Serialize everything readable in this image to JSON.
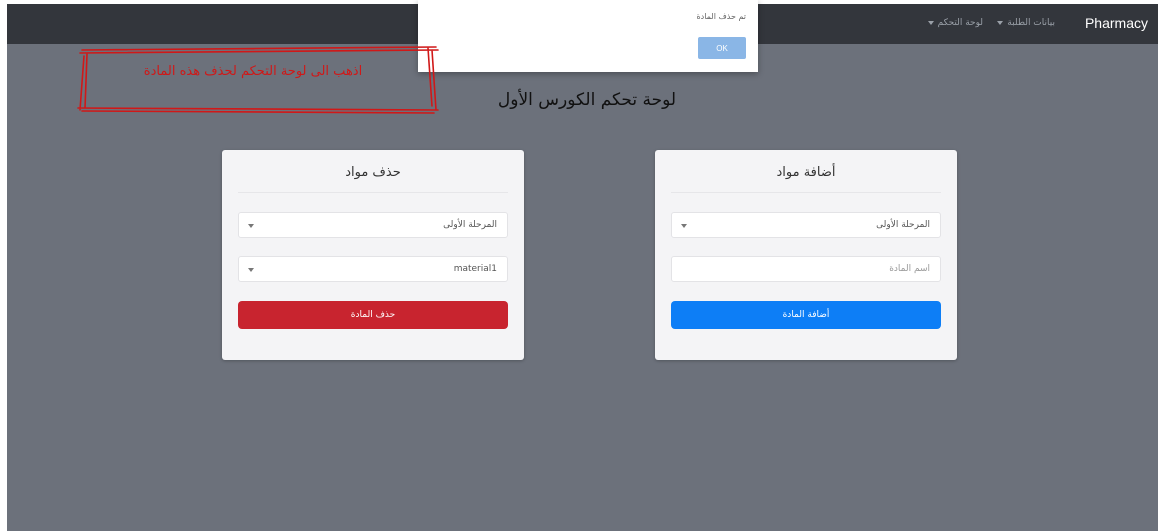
{
  "navbar": {
    "brand": "Pharmacy",
    "items": [
      {
        "label": "بيانات الطلبة"
      },
      {
        "label": "لوحة التحكم"
      }
    ]
  },
  "dialog": {
    "message": "تم حذف المادة",
    "ok_label": "OK"
  },
  "annotation": {
    "text": "اذهب الى لوحة التحكم لحذف هذه المادة",
    "color": "#d01818"
  },
  "page": {
    "title": "لوحة تحكم الكورس الأول"
  },
  "add_card": {
    "title": "أضافة مواد",
    "stage_select": "المرحلة الأولى",
    "name_placeholder": "أسم المادة",
    "button_label": "أضافة المادة"
  },
  "delete_card": {
    "title": "حذف مواد",
    "stage_select": "المرحلة الأولى",
    "material_select": "material1",
    "button_label": "حذف المادة"
  },
  "colors": {
    "navbar": "#33363c",
    "background": "#6c717b",
    "primary": "#0d7ef6",
    "danger": "#c8242f"
  }
}
